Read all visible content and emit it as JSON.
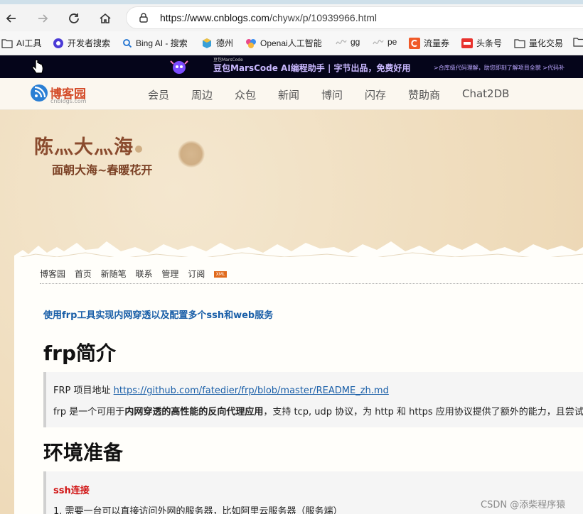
{
  "browser": {
    "url_host": "https://www.cnblogs.com",
    "url_path": "/chywx/p/10939966.html"
  },
  "bookmarks": [
    {
      "label": "AI工具"
    },
    {
      "label": "开发者搜索"
    },
    {
      "label": "Bing AI - 搜索"
    },
    {
      "label": "德州"
    },
    {
      "label": "Openai人工智能"
    },
    {
      "label": "gg"
    },
    {
      "label": "pe"
    },
    {
      "label": "流量券"
    },
    {
      "label": "头条号"
    },
    {
      "label": "量化交易"
    }
  ],
  "ad": {
    "small": "豆包MarsCode",
    "main": "豆包MarsCode AI编程助手 | 字节出品，免费好用",
    "sub": ">合库级代码理解，助您即刻了解项目全貌   >代码补"
  },
  "site_nav": {
    "logo_text": "博客园",
    "logo_sub": "cnblogs.com",
    "items": [
      "会员",
      "周边",
      "众包",
      "新闻",
      "博问",
      "闪存",
      "赞助商",
      "Chat2DB"
    ]
  },
  "blog": {
    "title": "陈灬大灬海",
    "subtitle": "面朝大海~春暖花开",
    "subnav": [
      "博客园",
      "首页",
      "新随笔",
      "联系",
      "管理",
      "订阅"
    ],
    "xml_badge": "XML"
  },
  "post": {
    "title": "使用frp工具实现内网穿透以及配置多个ssh和web服务",
    "h1_intro": "frp简介",
    "q1_prefix": "FRP 项目地址 ",
    "q1_link": "https://github.com/fatedier/frp/blob/master/README_zh.md",
    "q2_a": "frp 是一个可用于",
    "q2_bold": "内网穿透的高性能的反向代理应用",
    "q2_b": "，支持 tcp, udp 协议，为 http 和 https 应用协议提供了额外的能力，且尝试",
    "h1_env": "环境准备",
    "ssh_label": "ssh连接",
    "env_item1": "1. 需要一台可以直接访问外网的服务器，比如阿里云服务器（服务端）"
  },
  "watermark": "CSDN @添柴程序猿"
}
